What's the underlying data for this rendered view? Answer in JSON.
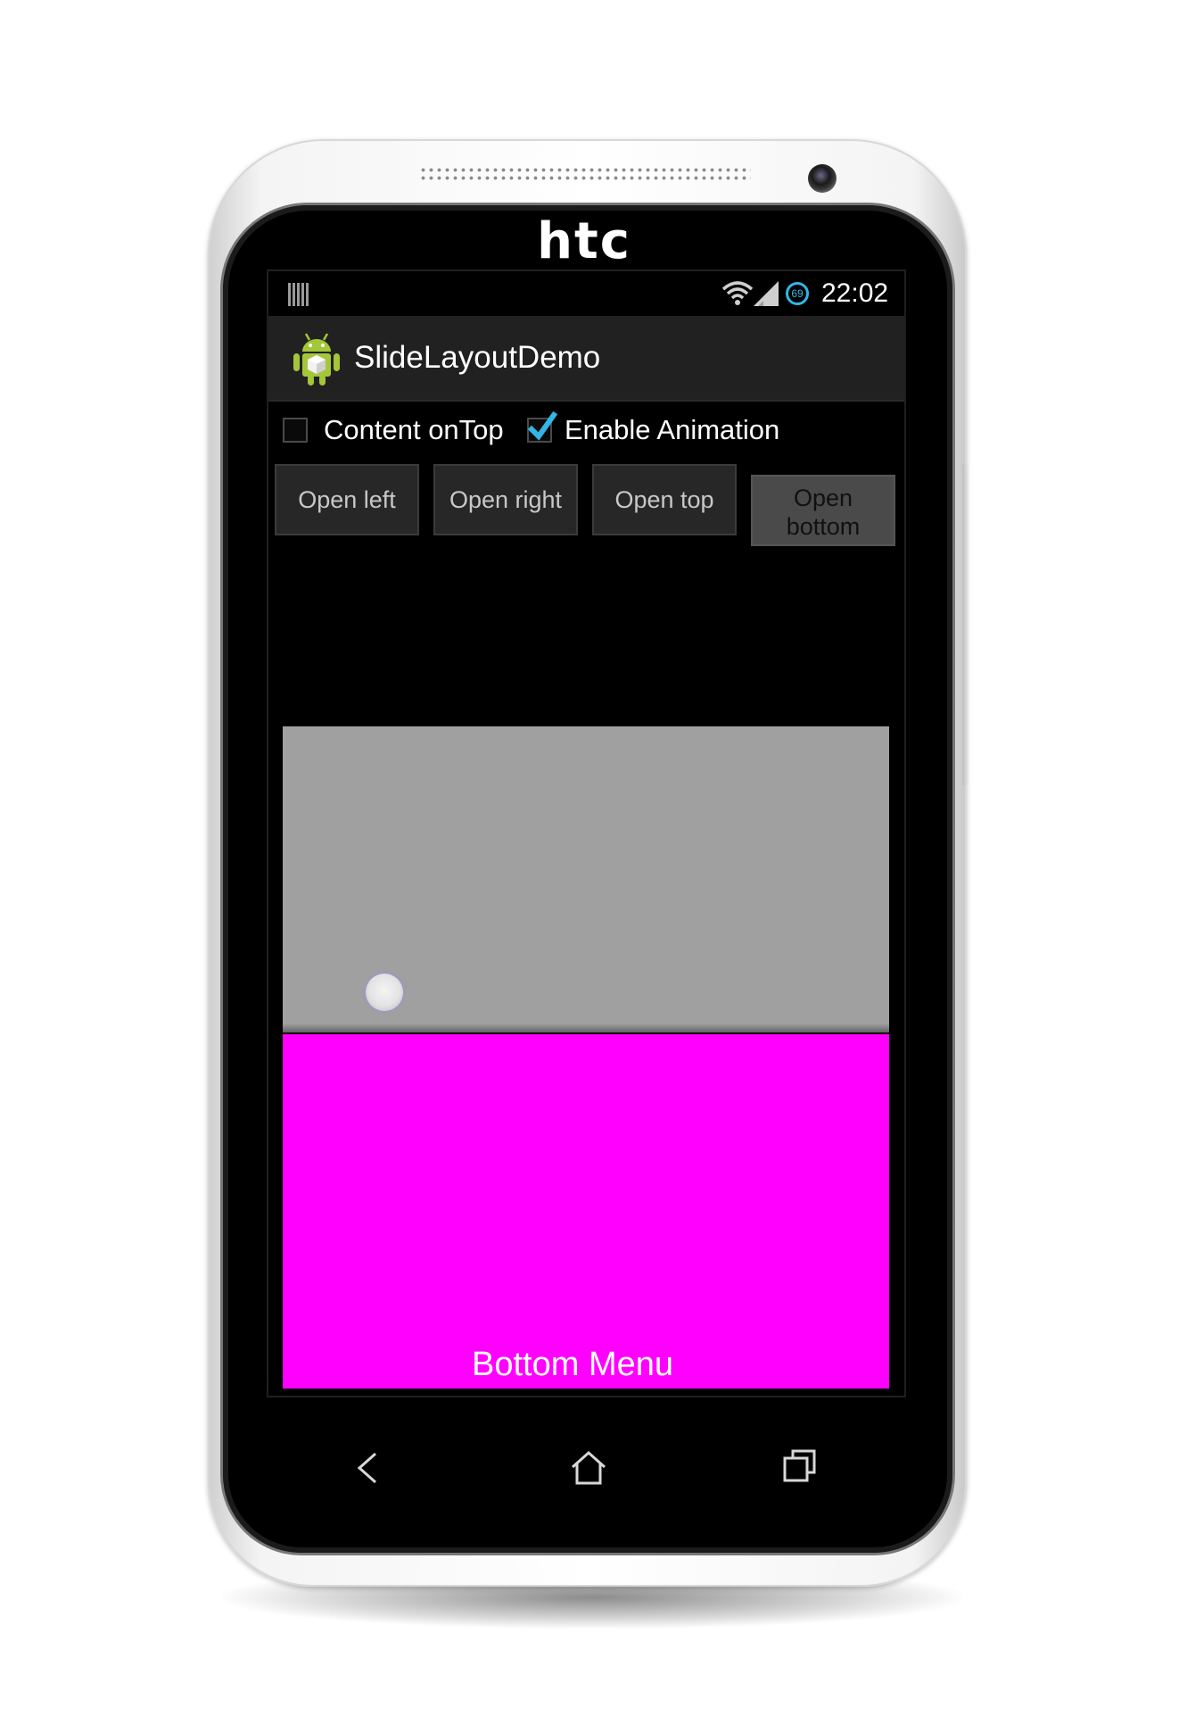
{
  "device": {
    "brand": "htc"
  },
  "status_bar": {
    "time": "22:02",
    "battery_level": "69",
    "icons": [
      "notification-icon",
      "wifi-icon",
      "signal-icon",
      "battery-icon"
    ]
  },
  "action_bar": {
    "title": "SlideLayoutDemo",
    "icon": "android-robot-icon"
  },
  "options": {
    "content_ontop": {
      "label": "Content onTop",
      "checked": false
    },
    "enable_animation": {
      "label": "Enable Animation",
      "checked": true
    }
  },
  "buttons": {
    "open_left": "Open left",
    "open_right": "Open right",
    "open_top": "Open top",
    "open_bottom": "Open bottom"
  },
  "content": {
    "bottom_menu_label": "Bottom Menu"
  },
  "nav_bar": {
    "icons": [
      "back-icon",
      "home-icon",
      "recent-apps-icon"
    ]
  },
  "colors": {
    "bottom_menu": "#ff00ff",
    "content_panel": "#a0a0a0",
    "accent": "#33b5e5"
  }
}
